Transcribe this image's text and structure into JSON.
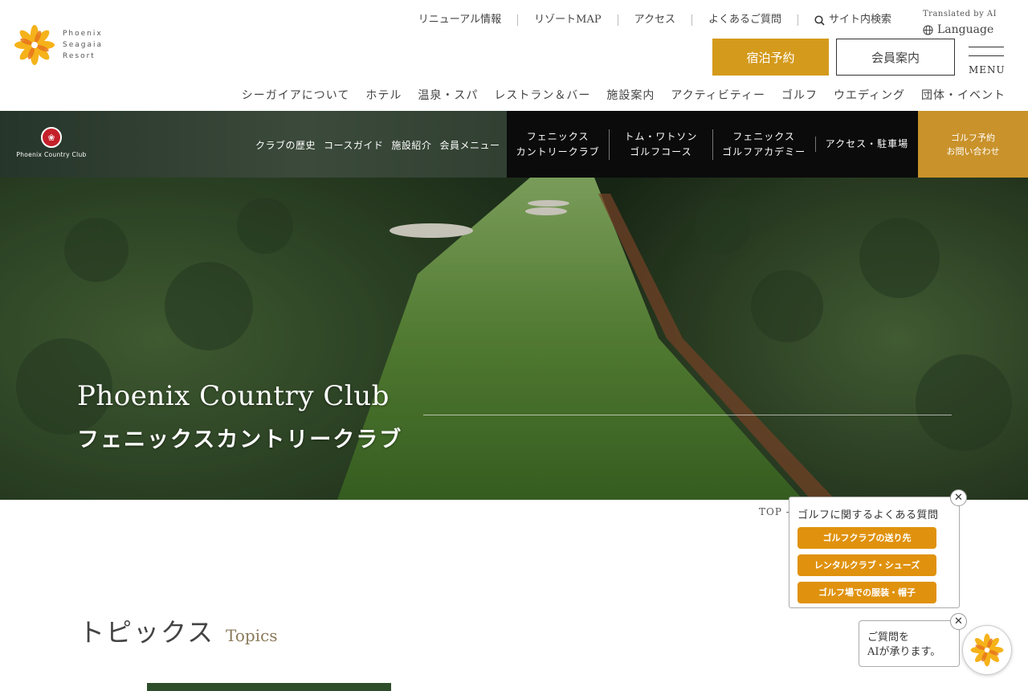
{
  "brand": {
    "line1": "Phoenix",
    "line2": "Seagaia",
    "line3": "Resort"
  },
  "util_nav": [
    "リニューアル情報",
    "リゾートMAP",
    "アクセス",
    "よくあるご質問",
    "サイト内検索"
  ],
  "lang": {
    "note": "Translated by AI",
    "label": "Language"
  },
  "buttons": {
    "stay": "宿泊予約",
    "member": "会員案内",
    "menu": "MENU"
  },
  "global_nav": [
    "シーガイアについて",
    "ホテル",
    "温泉・スパ",
    "レストラン＆バー",
    "施設案内",
    "アクティビティー",
    "ゴルフ",
    "ウエディング",
    "団体・イベント"
  ],
  "golf_nav": {
    "club_logo": "Phoenix Country Club",
    "links": [
      "クラブの歴史",
      "コースガイド",
      "施設紹介",
      "会員メニュー"
    ],
    "courses": [
      {
        "l1": "フェニックス",
        "l2": "カントリークラブ"
      },
      {
        "l1": "トム・ワトソン",
        "l2": "ゴルフコース"
      },
      {
        "l1": "フェニックス",
        "l2": "ゴルフアカデミー"
      },
      {
        "l1": "アクセス・駐車場",
        "l2": ""
      }
    ],
    "reserve": {
      "l1": "ゴルフ予約",
      "l2": "お問い合わせ"
    }
  },
  "hero": {
    "title_en": "Phoenix Country Club",
    "title_jp": "フェニックスカントリークラブ"
  },
  "breadcrumb": "TOP -",
  "topics": {
    "title_jp": "トピックス",
    "title_en": "Topics"
  },
  "faq": {
    "title": "ゴルフに関するよくある質問",
    "items": [
      "ゴルフクラブの送り先",
      "レンタルクラブ・シューズ",
      "ゴルフ場での服装・帽子"
    ]
  },
  "ai_chat": {
    "l1": "ご質問を",
    "l2": "AIが承ります。"
  },
  "colors": {
    "accent": "#d49a1c",
    "faq_button": "#e0920e",
    "dark_nav": "#0b0b0b"
  }
}
